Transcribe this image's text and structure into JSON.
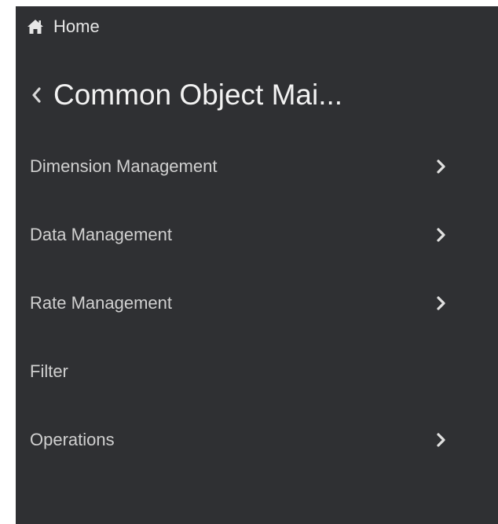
{
  "nav": {
    "home_label": "Home",
    "home_icon": "home-icon",
    "back_icon": "chevron-left-icon",
    "section_title": "Common Object Mai..."
  },
  "menu": {
    "items": [
      {
        "label": "Dimension Management",
        "has_submenu": true
      },
      {
        "label": "Data Management",
        "has_submenu": true
      },
      {
        "label": "Rate Management",
        "has_submenu": true
      },
      {
        "label": "Filter",
        "has_submenu": false
      },
      {
        "label": "Operations",
        "has_submenu": true
      }
    ]
  },
  "colors": {
    "panel_background": "#2f3033",
    "text": "#d0d0d0",
    "title_text": "#f2f2f2"
  }
}
